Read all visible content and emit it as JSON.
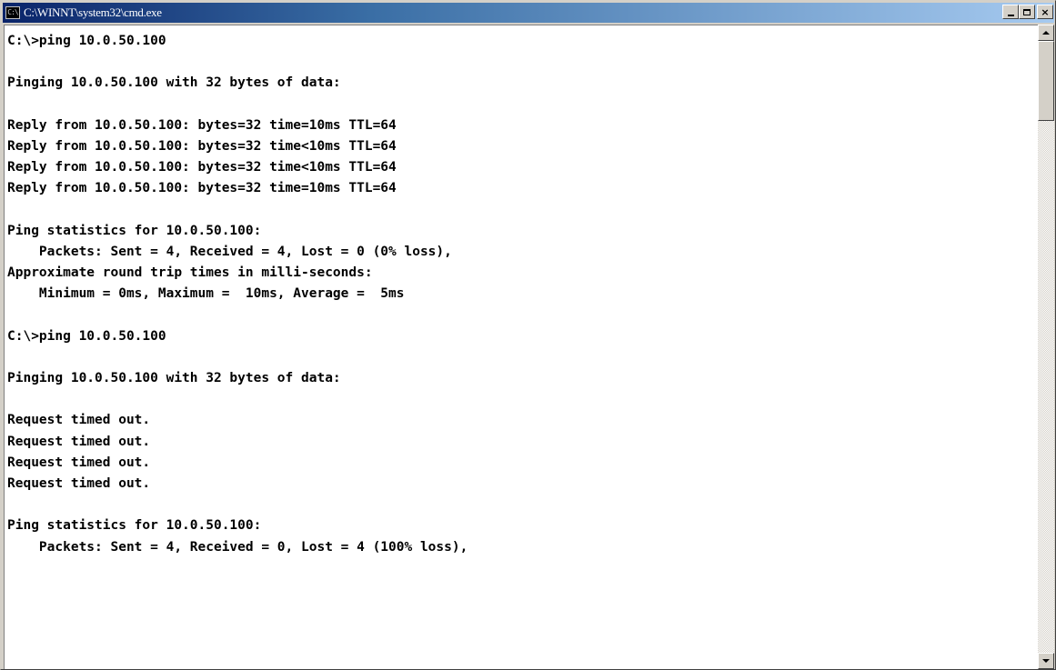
{
  "window": {
    "title": "C:\\WINNT\\system32\\cmd.exe",
    "icon": "console-icon",
    "icon_glyph": "C:\\",
    "buttons": {
      "minimize_icon": "minimize-icon",
      "maximize_icon": "maximize-icon",
      "close_icon": "close-icon",
      "close_glyph": "×"
    }
  },
  "colors": {
    "titlebar_start": "#0a246a",
    "titlebar_end": "#a6caf0",
    "console_background": "#ffffff",
    "console_text": "#000000"
  },
  "console": {
    "lines": [
      "C:\\>ping 10.0.50.100",
      "",
      "Pinging 10.0.50.100 with 32 bytes of data:",
      "",
      "Reply from 10.0.50.100: bytes=32 time=10ms TTL=64",
      "Reply from 10.0.50.100: bytes=32 time<10ms TTL=64",
      "Reply from 10.0.50.100: bytes=32 time<10ms TTL=64",
      "Reply from 10.0.50.100: bytes=32 time=10ms TTL=64",
      "",
      "Ping statistics for 10.0.50.100:",
      "    Packets: Sent = 4, Received = 4, Lost = 0 (0% loss),",
      "Approximate round trip times in milli-seconds:",
      "    Minimum = 0ms, Maximum =  10ms, Average =  5ms",
      "",
      "C:\\>ping 10.0.50.100",
      "",
      "Pinging 10.0.50.100 with 32 bytes of data:",
      "",
      "Request timed out.",
      "Request timed out.",
      "Request timed out.",
      "Request timed out.",
      "",
      "Ping statistics for 10.0.50.100:",
      "    Packets: Sent = 4, Received = 0, Lost = 4 (100% loss),"
    ]
  },
  "scrollbar": {
    "up_icon": "scroll-up-arrow-icon",
    "down_icon": "scroll-down-arrow-icon",
    "position_fraction": 0.0
  }
}
